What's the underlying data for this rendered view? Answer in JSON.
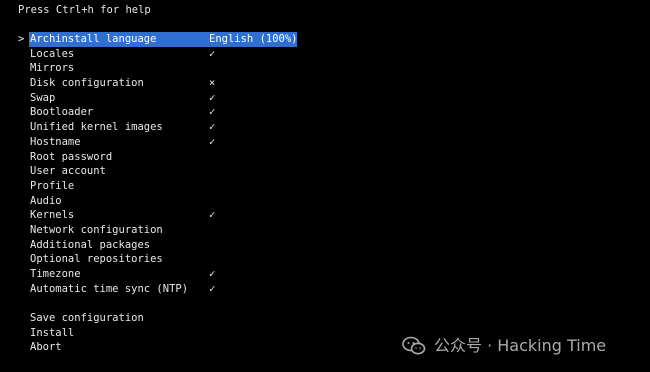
{
  "help_text": "Press Ctrl+h for help",
  "menu": {
    "cursor": ">",
    "items": [
      {
        "label": "Archinstall language",
        "value": "English (100%)",
        "selected": true
      },
      {
        "label": "Locales",
        "value": "✓"
      },
      {
        "label": "Mirrors",
        "value": ""
      },
      {
        "label": "Disk configuration",
        "value": "×"
      },
      {
        "label": "Swap",
        "value": "✓"
      },
      {
        "label": "Bootloader",
        "value": "✓"
      },
      {
        "label": "Unified kernel images",
        "value": "✓"
      },
      {
        "label": "Hostname",
        "value": "✓"
      },
      {
        "label": "Root password",
        "value": ""
      },
      {
        "label": "User account",
        "value": ""
      },
      {
        "label": "Profile",
        "value": ""
      },
      {
        "label": "Audio",
        "value": ""
      },
      {
        "label": "Kernels",
        "value": "✓"
      },
      {
        "label": "Network configuration",
        "value": ""
      },
      {
        "label": "Additional packages",
        "value": ""
      },
      {
        "label": "Optional repositories",
        "value": ""
      },
      {
        "label": "Timezone",
        "value": "✓"
      },
      {
        "label": "Automatic time sync (NTP)",
        "value": "✓"
      }
    ],
    "actions": [
      {
        "label": "Save configuration"
      },
      {
        "label": "Install"
      },
      {
        "label": "Abort"
      }
    ]
  },
  "watermark": {
    "text": "公众号 · Hacking Time",
    "icon": "wechat-icon"
  },
  "colors": {
    "background": "#000000",
    "foreground": "#e8e8e8",
    "selection": "#2f6fd1"
  }
}
